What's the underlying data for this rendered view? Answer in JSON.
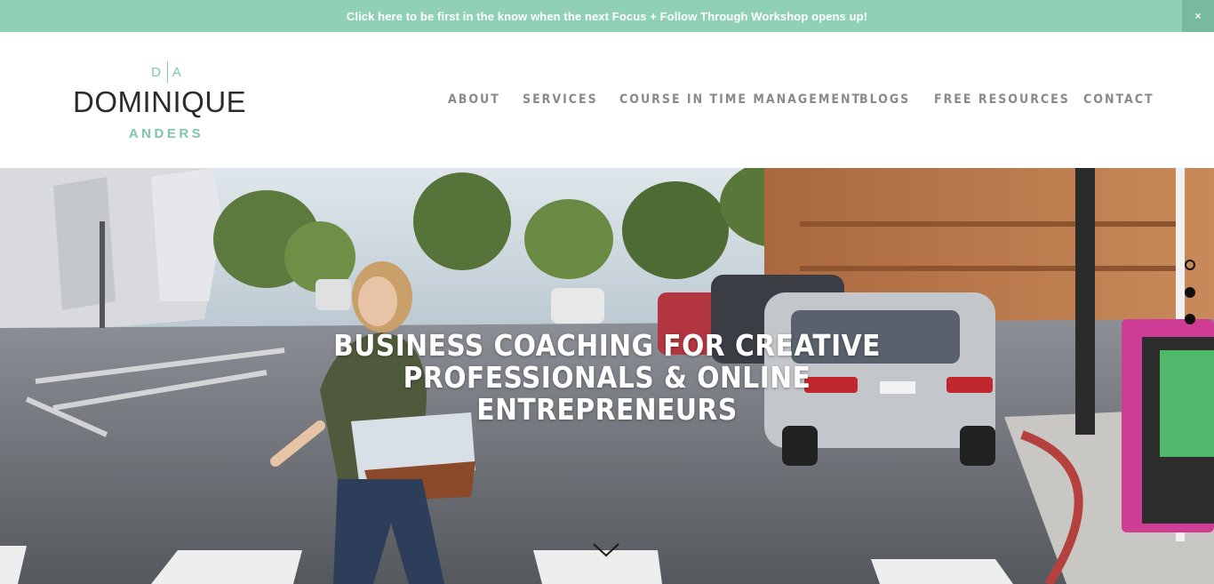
{
  "announcement": {
    "text": "Click here to be first in the know when the next Focus + Follow Through Workshop opens up!",
    "close_label": "×",
    "color": "#8fd0b6"
  },
  "logo": {
    "monogram_left": "D",
    "monogram_right": "A",
    "first_name": "DOMINIQUE",
    "last_name": "ANDERS"
  },
  "nav": {
    "items": [
      {
        "label": "ABOUT"
      },
      {
        "label": "SERVICES"
      },
      {
        "label": "COURSE IN TIME MANAGEMENT"
      },
      {
        "label": "BLOGS"
      },
      {
        "label": "FREE RESOURCES"
      },
      {
        "label": "CONTACT"
      }
    ]
  },
  "hero": {
    "title_line1": "BUSINESS COACHING FOR CREATIVE",
    "title_line2": "PROFESSIONALS & ONLINE",
    "title_line3": "ENTREPRENEURS",
    "scroll_icon": "chevron-down-icon",
    "slide_dots": [
      {
        "active": true
      },
      {
        "active": false
      },
      {
        "active": false
      }
    ]
  },
  "colors": {
    "accent": "#8fd0b6",
    "nav_text": "#8a8a8a",
    "logo_dark": "#2b2b2b"
  }
}
